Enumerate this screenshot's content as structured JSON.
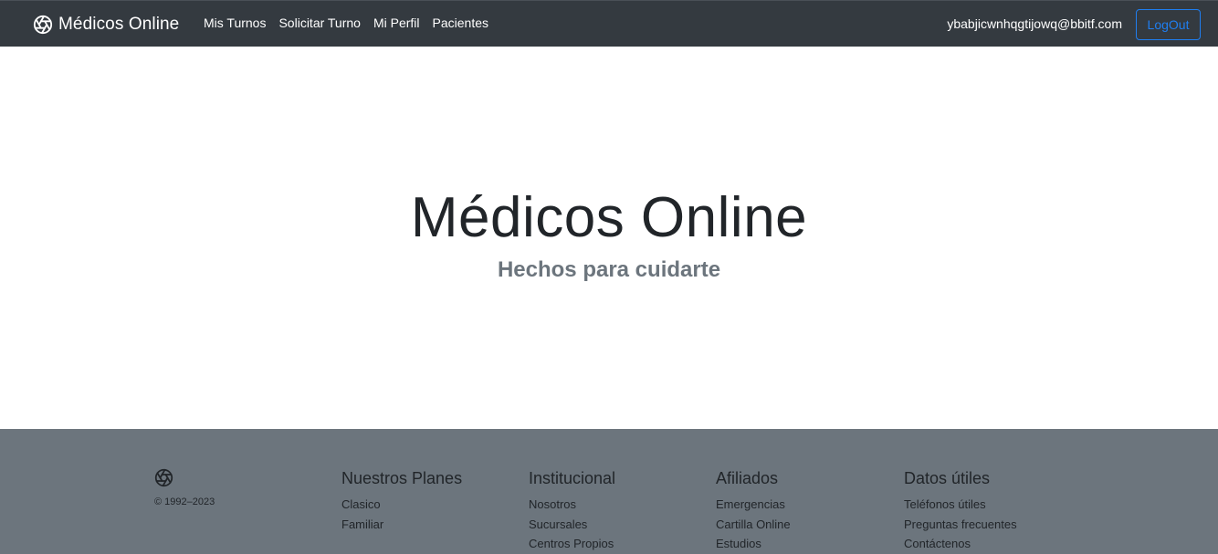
{
  "navbar": {
    "brand": "Médicos Online",
    "links": [
      "Mis Turnos",
      "Solicitar Turno",
      "Mi Perfil",
      "Pacientes"
    ],
    "user_email": "ybabjicwnhqgtijowq@bbitf.com",
    "logout_label": "LogOut",
    "brand_icon": "aperture-icon"
  },
  "hero": {
    "title": "Médicos Online",
    "subtitle": "Hechos para cuidarte"
  },
  "footer": {
    "logo_icon": "aperture-icon",
    "copyright": "© 1992–2023",
    "columns": [
      {
        "title": "Nuestros Planes",
        "links": [
          "Clasico",
          "Familiar"
        ]
      },
      {
        "title": "Institucional",
        "links": [
          "Nosotros",
          "Sucursales",
          "Centros Propios"
        ]
      },
      {
        "title": "Afiliados",
        "links": [
          "Emergencias",
          "Cartilla Online",
          "Estudios"
        ]
      },
      {
        "title": "Datos útiles",
        "links": [
          "Teléfonos útiles",
          "Preguntas frecuentes",
          "Contáctenos"
        ]
      }
    ]
  },
  "colors": {
    "navbar_bg": "#343a40",
    "footer_bg": "#6c757d",
    "accent": "#1f7ef0",
    "subtitle": "#6c757d"
  }
}
